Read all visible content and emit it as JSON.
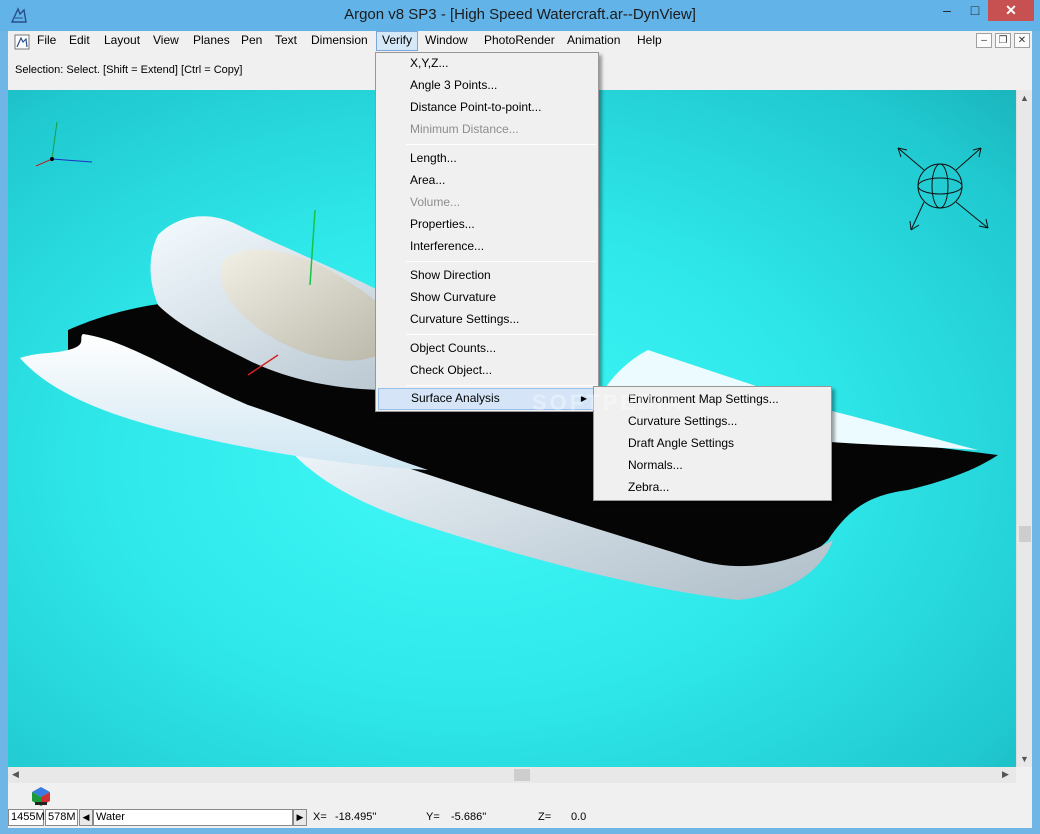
{
  "window": {
    "title": "Argon v8 SP3 - [High Speed Watercraft.ar--DynView]",
    "controls": {
      "minimize": "–",
      "maximize": "□",
      "close": "✕"
    }
  },
  "menubar": {
    "items": [
      "File",
      "Edit",
      "Layout",
      "View",
      "Planes",
      "Pen",
      "Text",
      "Dimension",
      "Verify",
      "Window",
      "PhotoRender",
      "Animation",
      "Help"
    ],
    "active": "Verify",
    "mdi_controls": {
      "minimize": "–",
      "restore": "❐",
      "close": "✕"
    }
  },
  "prompt": "Selection: Select. [Shift = Extend] [Ctrl = Copy]",
  "verify_menu": {
    "items": [
      {
        "label": "X,Y,Z...",
        "enabled": true
      },
      {
        "label": "Angle 3 Points...",
        "enabled": true
      },
      {
        "label": "Distance Point-to-point...",
        "enabled": true
      },
      {
        "label": "Minimum Distance...",
        "enabled": false
      },
      {
        "label": "Length...",
        "enabled": true
      },
      {
        "label": "Area...",
        "enabled": true
      },
      {
        "label": "Volume...",
        "enabled": false
      },
      {
        "label": "Properties...",
        "enabled": true
      },
      {
        "label": "Interference...",
        "enabled": true
      },
      {
        "label": "Show Direction",
        "enabled": true
      },
      {
        "label": "Show Curvature",
        "enabled": true
      },
      {
        "label": "Curvature Settings...",
        "enabled": true
      },
      {
        "label": "Object Counts...",
        "enabled": true
      },
      {
        "label": "Check Object...",
        "enabled": true
      },
      {
        "label": "Surface Analysis",
        "enabled": true,
        "submenu": true,
        "highlighted": true
      }
    ]
  },
  "surface_menu": {
    "items": [
      "Environment Map Settings...",
      "Curvature Settings...",
      "Draft Angle Settings",
      "Normals...",
      "Zebra..."
    ]
  },
  "watermark": "SOFTPEDIA",
  "status": {
    "memory_total": "1455M",
    "memory_used": "578M",
    "layer": "Water",
    "x_label": "X=",
    "x_value": "-18.495''",
    "y_label": "Y=",
    "y_value": "-5.686''",
    "z_label": "Z=",
    "z_value": "0.0"
  },
  "colors": {
    "viewport_center": "#3ff8f6",
    "viewport_edge": "#1bb5bd",
    "menu_highlight": "#d5e5f7",
    "titlebar": "#62b3e8",
    "close_button": "#c75050"
  },
  "icons": {
    "app": "argon-app-icon",
    "axis_triad": "xyz-axis-icon",
    "navigator": "view-navigator-sphere-icon",
    "render": "render-cube-icon"
  }
}
